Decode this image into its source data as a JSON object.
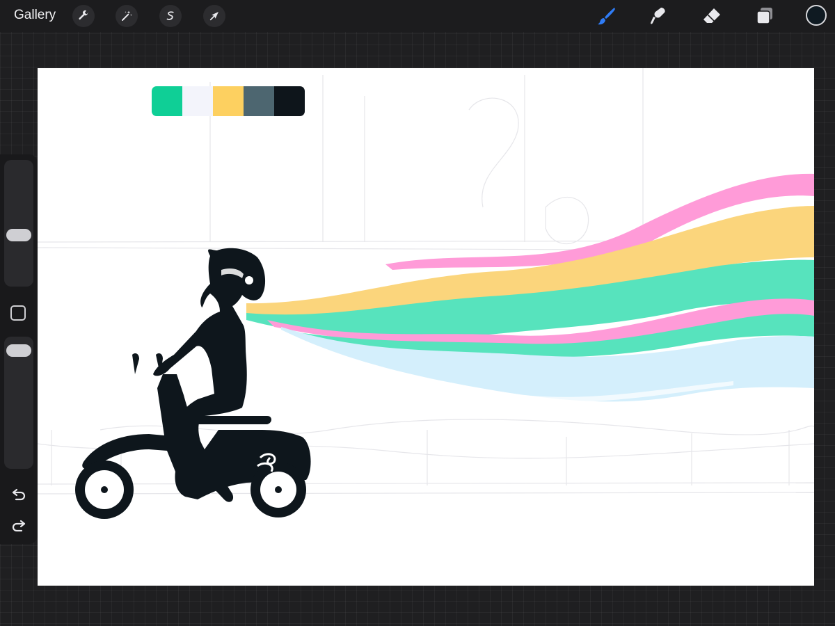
{
  "toolbar": {
    "gallery_label": "Gallery",
    "left_tools": [
      {
        "icon": "wrench-icon"
      },
      {
        "icon": "magic-wand-icon"
      },
      {
        "icon": "selection-icon"
      },
      {
        "icon": "transform-arrow-icon"
      }
    ],
    "right_tools": [
      {
        "icon": "brush-icon",
        "active": true
      },
      {
        "icon": "smudge-icon"
      },
      {
        "icon": "eraser-icon"
      },
      {
        "icon": "layers-icon"
      }
    ],
    "current_color": "#0f1a22",
    "accent_color": "#2f7cf6"
  },
  "sidebar": {
    "brush_size_level": 0.38,
    "opacity_level": 1.0,
    "undo_icon": "undo-arrow-icon",
    "redo_icon": "redo-arrow-icon"
  },
  "palette": {
    "swatches": [
      "#0fcf96",
      "#f3f4fb",
      "#fdd060",
      "#4d6670",
      "#0e151b"
    ]
  },
  "artwork": {
    "subject": "scooter-rider-illustration",
    "stripe_colors": {
      "pink": "#ff9bd8",
      "yellow": "#fbd57c",
      "green": "#57e3bd",
      "light_blue": "#d4effc",
      "ink": "#0e161c"
    }
  }
}
